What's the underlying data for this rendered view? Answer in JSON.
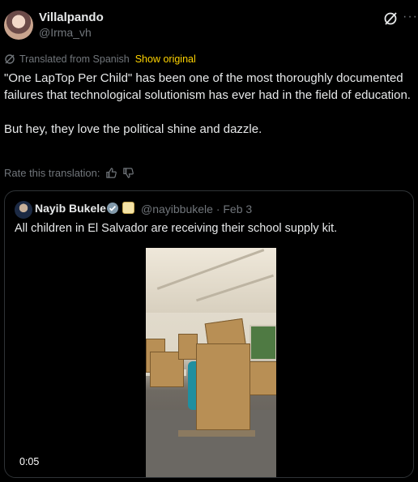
{
  "author": {
    "name": "Villalpando",
    "handle": "@Irma_vh"
  },
  "translation": {
    "label": "Translated from Spanish",
    "show_original": "Show original"
  },
  "tweet": {
    "text": "\"One LapTop Per Child\" has been one of the most thoroughly documented failures that technological solutionism has ever had in the field of education.\n\nBut hey, they love the political shine and dazzle."
  },
  "rating": {
    "label": "Rate this translation:"
  },
  "quote": {
    "name": "Nayib Bukele",
    "handle_date": "@nayibbukele · Feb 3",
    "text": "All children in El Salvador are receiving their school supply kit.",
    "video_time": "0:05"
  },
  "icons": {
    "grok": "grok-icon",
    "more": "more-icon",
    "translate": "translate-icon",
    "thumbs_up": "thumbs-up-icon",
    "thumbs_down": "thumbs-down-icon",
    "verified": "verified-badge-icon"
  },
  "colors": {
    "accent": "#ffd400",
    "verified": "#829aab",
    "muted": "#71767b",
    "text": "#e7e9ea"
  }
}
